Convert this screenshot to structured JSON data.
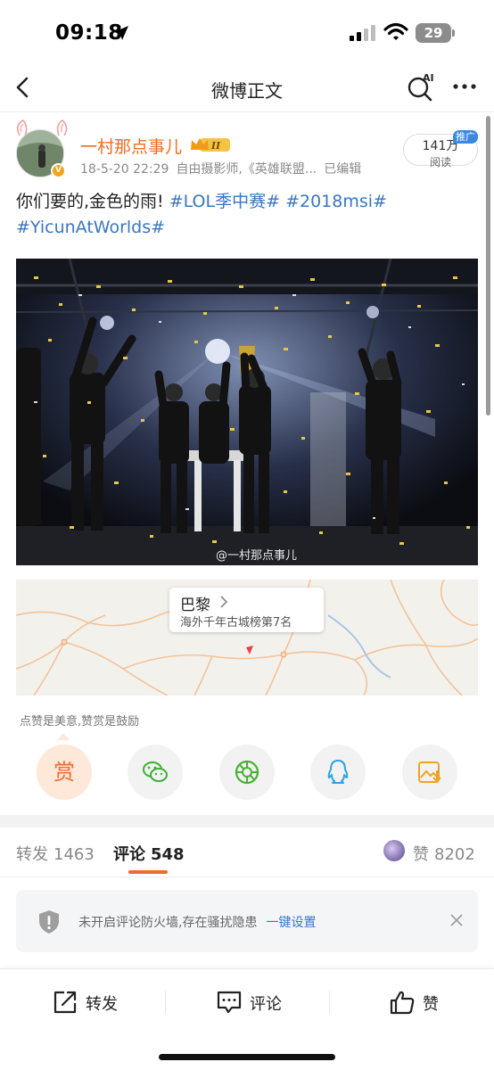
{
  "status_bar": {
    "time": "09:18",
    "battery": "29"
  },
  "nav": {
    "title": "微博正文",
    "ai_label": "AI"
  },
  "author": {
    "name": "一村那点事儿",
    "level_badge": "II",
    "verified_mark": "V",
    "date": "18-5-20 22:29",
    "source": "自由摄影师,《英雄联盟...",
    "edited": "已编辑",
    "reads_count": "141万",
    "reads_label": "阅读",
    "promo_tag": "推广"
  },
  "post": {
    "text": "你们要的,金色的雨!",
    "topics": [
      "#LOL季中赛#",
      "#2018msi#",
      "#YicunAtWorlds#"
    ],
    "image_watermark": "@一村那点事儿"
  },
  "location": {
    "city": "巴黎",
    "ranking": "海外千年古城榜第7名"
  },
  "reward": {
    "hint": "点赞是美意,赞赏是鼓励",
    "reward_label": "赏"
  },
  "share_targets": [
    "wechat-icon",
    "moments-icon",
    "qq-icon",
    "save-image-icon"
  ],
  "tabs": {
    "repost_label": "转发",
    "repost_count": "1463",
    "comment_label": "评论",
    "comment_count": "548",
    "like_label": "赞",
    "like_count": "8202"
  },
  "notice": {
    "text": "未开启评论防火墙,存在骚扰隐患",
    "link": "一键设置"
  },
  "bottom_bar": {
    "repost": "转发",
    "comment": "评论",
    "like": "赞"
  },
  "colors": {
    "accent": "#f26a2a",
    "link": "#3a76c3",
    "author_name": "#f06b1d"
  }
}
